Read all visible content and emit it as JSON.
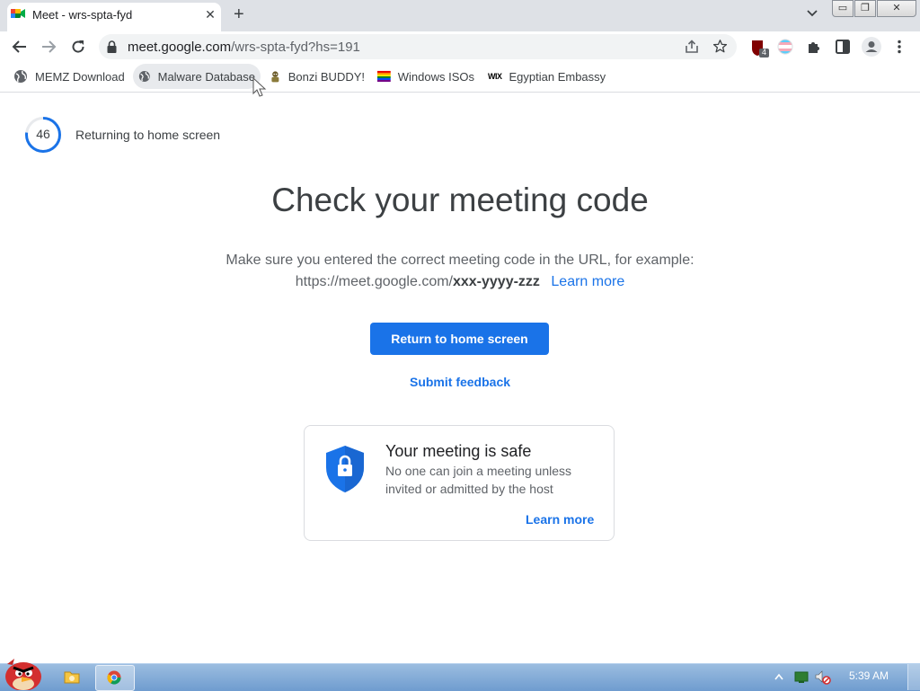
{
  "browser": {
    "tab": {
      "title": "Meet - wrs-spta-fyd",
      "close_label": "✕",
      "favicon_icon": "google-meet-icon"
    },
    "new_tab_label": "+",
    "window_buttons": {
      "minimize": "▭",
      "restore": "❐",
      "close": "✕"
    },
    "url": {
      "host": "meet.google.com",
      "path": "/wrs-spta-fyd?hs=191"
    },
    "bookmarks": [
      {
        "label": "MEMZ Download",
        "icon": "globe-icon"
      },
      {
        "label": "Malware Database",
        "icon": "globe-icon"
      },
      {
        "label": "Bonzi BUDDY!",
        "icon": "bonzi-icon"
      },
      {
        "label": "Windows ISOs",
        "icon": "rainbow-flag-icon"
      },
      {
        "label": "Egyptian Embassy",
        "icon": "wix-icon"
      }
    ],
    "extension_badge": "4",
    "wix_text": "WIX"
  },
  "page": {
    "countdown": {
      "value": "46",
      "label": "Returning to home screen",
      "progress_fraction": 0.77
    },
    "headline": "Check your meeting code",
    "description_line1": "Make sure you entered the correct meeting code in the URL, for example:",
    "example_url_prefix": "https://meet.google.com/",
    "example_code": "xxx-yyyy-zzz",
    "learn_more": "Learn more",
    "return_button": "Return to home screen",
    "submit_feedback": "Submit feedback",
    "safe_card": {
      "title": "Your meeting is safe",
      "body": "No one can join a meeting unless invited or admitted by the host",
      "link": "Learn more"
    }
  },
  "taskbar": {
    "clock": "5:39 AM"
  },
  "colors": {
    "accent": "#1a73e8",
    "tabstrip": "#dee1e6"
  }
}
